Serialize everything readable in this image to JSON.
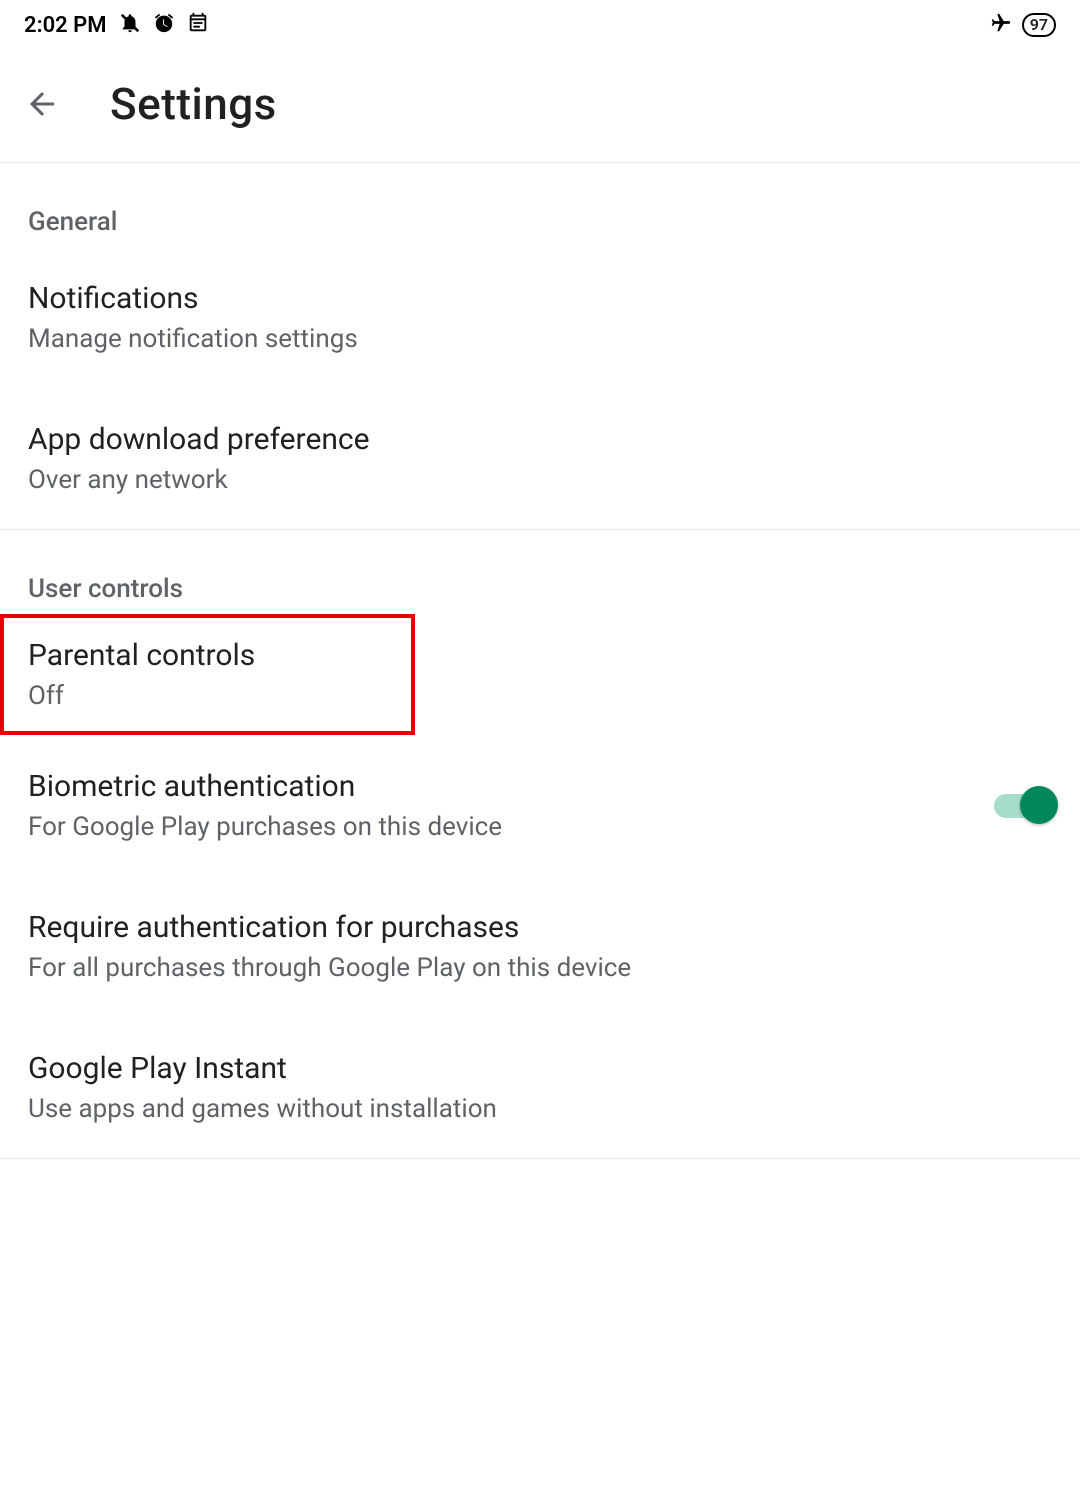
{
  "status_bar": {
    "time": "2:02 PM",
    "battery": "97"
  },
  "header": {
    "title": "Settings"
  },
  "sections": [
    {
      "header": "General",
      "items": [
        {
          "title": "Notifications",
          "subtitle": "Manage notification settings"
        },
        {
          "title": "App download preference",
          "subtitle": "Over any network"
        }
      ]
    },
    {
      "header": "User controls",
      "items": [
        {
          "title": "Parental controls",
          "subtitle": "Off",
          "highlighted": true
        },
        {
          "title": "Biometric authentication",
          "subtitle": "For Google Play purchases on this device",
          "toggle": true,
          "toggle_state": "on"
        },
        {
          "title": "Require authentication for purchases",
          "subtitle": "For all purchases through Google Play on this device"
        },
        {
          "title": "Google Play Instant",
          "subtitle": "Use apps and games without installation"
        }
      ]
    }
  ]
}
